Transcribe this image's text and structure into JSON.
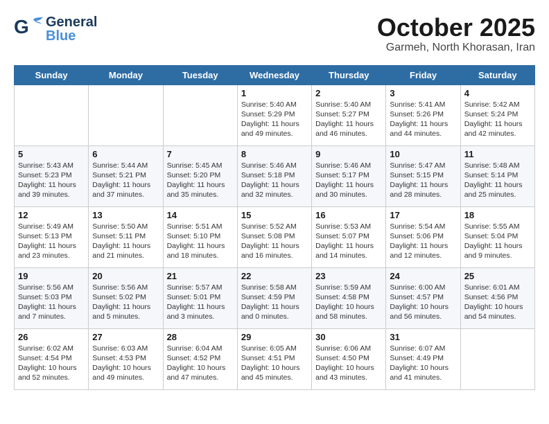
{
  "header": {
    "logo_line1": "General",
    "logo_line2": "Blue",
    "title": "October 2025",
    "subtitle": "Garmeh, North Khorasan, Iran"
  },
  "weekdays": [
    "Sunday",
    "Monday",
    "Tuesday",
    "Wednesday",
    "Thursday",
    "Friday",
    "Saturday"
  ],
  "weeks": [
    [
      {
        "day": "",
        "info": ""
      },
      {
        "day": "",
        "info": ""
      },
      {
        "day": "",
        "info": ""
      },
      {
        "day": "1",
        "info": "Sunrise: 5:40 AM\nSunset: 5:29 PM\nDaylight: 11 hours\nand 49 minutes."
      },
      {
        "day": "2",
        "info": "Sunrise: 5:40 AM\nSunset: 5:27 PM\nDaylight: 11 hours\nand 46 minutes."
      },
      {
        "day": "3",
        "info": "Sunrise: 5:41 AM\nSunset: 5:26 PM\nDaylight: 11 hours\nand 44 minutes."
      },
      {
        "day": "4",
        "info": "Sunrise: 5:42 AM\nSunset: 5:24 PM\nDaylight: 11 hours\nand 42 minutes."
      }
    ],
    [
      {
        "day": "5",
        "info": "Sunrise: 5:43 AM\nSunset: 5:23 PM\nDaylight: 11 hours\nand 39 minutes."
      },
      {
        "day": "6",
        "info": "Sunrise: 5:44 AM\nSunset: 5:21 PM\nDaylight: 11 hours\nand 37 minutes."
      },
      {
        "day": "7",
        "info": "Sunrise: 5:45 AM\nSunset: 5:20 PM\nDaylight: 11 hours\nand 35 minutes."
      },
      {
        "day": "8",
        "info": "Sunrise: 5:46 AM\nSunset: 5:18 PM\nDaylight: 11 hours\nand 32 minutes."
      },
      {
        "day": "9",
        "info": "Sunrise: 5:46 AM\nSunset: 5:17 PM\nDaylight: 11 hours\nand 30 minutes."
      },
      {
        "day": "10",
        "info": "Sunrise: 5:47 AM\nSunset: 5:15 PM\nDaylight: 11 hours\nand 28 minutes."
      },
      {
        "day": "11",
        "info": "Sunrise: 5:48 AM\nSunset: 5:14 PM\nDaylight: 11 hours\nand 25 minutes."
      }
    ],
    [
      {
        "day": "12",
        "info": "Sunrise: 5:49 AM\nSunset: 5:13 PM\nDaylight: 11 hours\nand 23 minutes."
      },
      {
        "day": "13",
        "info": "Sunrise: 5:50 AM\nSunset: 5:11 PM\nDaylight: 11 hours\nand 21 minutes."
      },
      {
        "day": "14",
        "info": "Sunrise: 5:51 AM\nSunset: 5:10 PM\nDaylight: 11 hours\nand 18 minutes."
      },
      {
        "day": "15",
        "info": "Sunrise: 5:52 AM\nSunset: 5:08 PM\nDaylight: 11 hours\nand 16 minutes."
      },
      {
        "day": "16",
        "info": "Sunrise: 5:53 AM\nSunset: 5:07 PM\nDaylight: 11 hours\nand 14 minutes."
      },
      {
        "day": "17",
        "info": "Sunrise: 5:54 AM\nSunset: 5:06 PM\nDaylight: 11 hours\nand 12 minutes."
      },
      {
        "day": "18",
        "info": "Sunrise: 5:55 AM\nSunset: 5:04 PM\nDaylight: 11 hours\nand 9 minutes."
      }
    ],
    [
      {
        "day": "19",
        "info": "Sunrise: 5:56 AM\nSunset: 5:03 PM\nDaylight: 11 hours\nand 7 minutes."
      },
      {
        "day": "20",
        "info": "Sunrise: 5:56 AM\nSunset: 5:02 PM\nDaylight: 11 hours\nand 5 minutes."
      },
      {
        "day": "21",
        "info": "Sunrise: 5:57 AM\nSunset: 5:01 PM\nDaylight: 11 hours\nand 3 minutes."
      },
      {
        "day": "22",
        "info": "Sunrise: 5:58 AM\nSunset: 4:59 PM\nDaylight: 11 hours\nand 0 minutes."
      },
      {
        "day": "23",
        "info": "Sunrise: 5:59 AM\nSunset: 4:58 PM\nDaylight: 10 hours\nand 58 minutes."
      },
      {
        "day": "24",
        "info": "Sunrise: 6:00 AM\nSunset: 4:57 PM\nDaylight: 10 hours\nand 56 minutes."
      },
      {
        "day": "25",
        "info": "Sunrise: 6:01 AM\nSunset: 4:56 PM\nDaylight: 10 hours\nand 54 minutes."
      }
    ],
    [
      {
        "day": "26",
        "info": "Sunrise: 6:02 AM\nSunset: 4:54 PM\nDaylight: 10 hours\nand 52 minutes."
      },
      {
        "day": "27",
        "info": "Sunrise: 6:03 AM\nSunset: 4:53 PM\nDaylight: 10 hours\nand 49 minutes."
      },
      {
        "day": "28",
        "info": "Sunrise: 6:04 AM\nSunset: 4:52 PM\nDaylight: 10 hours\nand 47 minutes."
      },
      {
        "day": "29",
        "info": "Sunrise: 6:05 AM\nSunset: 4:51 PM\nDaylight: 10 hours\nand 45 minutes."
      },
      {
        "day": "30",
        "info": "Sunrise: 6:06 AM\nSunset: 4:50 PM\nDaylight: 10 hours\nand 43 minutes."
      },
      {
        "day": "31",
        "info": "Sunrise: 6:07 AM\nSunset: 4:49 PM\nDaylight: 10 hours\nand 41 minutes."
      },
      {
        "day": "",
        "info": ""
      }
    ]
  ]
}
